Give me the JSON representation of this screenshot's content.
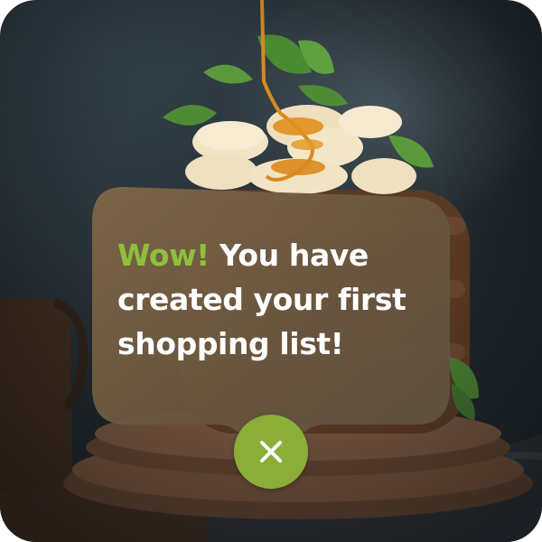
{
  "toast": {
    "highlight": "Wow!",
    "message": "You have created your first shopping list!",
    "close_icon": "close-icon",
    "accent_color": "#8fbf3c",
    "button_color": "#8aae38"
  }
}
